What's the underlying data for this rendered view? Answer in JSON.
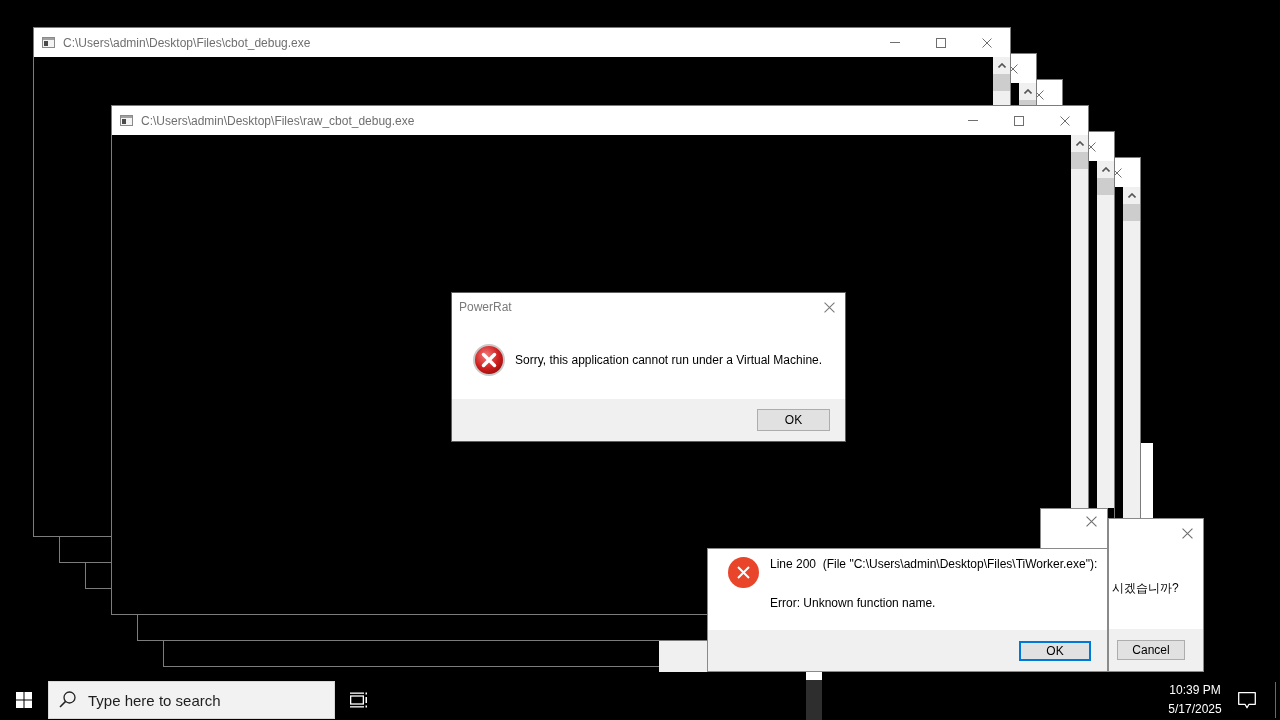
{
  "console_windows": [
    {
      "title": "C:\\Users\\admin\\Desktop\\Files\\cbot_debug.exe",
      "active": false
    },
    {
      "active": false
    },
    {
      "active": false
    },
    {
      "title": "C:\\Users\\admin\\Desktop\\Files\\raw_cbot_debug.exe",
      "active": false
    },
    {
      "active": false
    },
    {
      "active": false
    }
  ],
  "dialogs": {
    "powerrat": {
      "title": "PowerRat",
      "active": false,
      "message": "Sorry, this application cannot run under a Virtual Machine.",
      "button": {
        "label": "OK",
        "focused": false
      }
    },
    "script_error": {
      "lines": [
        "Line 200  (File \"C:\\Users\\admin\\Desktop\\Files\\TiWorker.exe\"):",
        "Error: Unknown function name."
      ],
      "button": {
        "label": "OK",
        "focused": true
      }
    },
    "confirm": {
      "message": "시겠습니까?",
      "button": {
        "label": "Cancel",
        "focused": false
      }
    }
  },
  "taskbar": {
    "search": {
      "placeholder": "Type here to search"
    },
    "clock": {
      "time": "10:39 PM",
      "date": "5/17/2025"
    }
  }
}
